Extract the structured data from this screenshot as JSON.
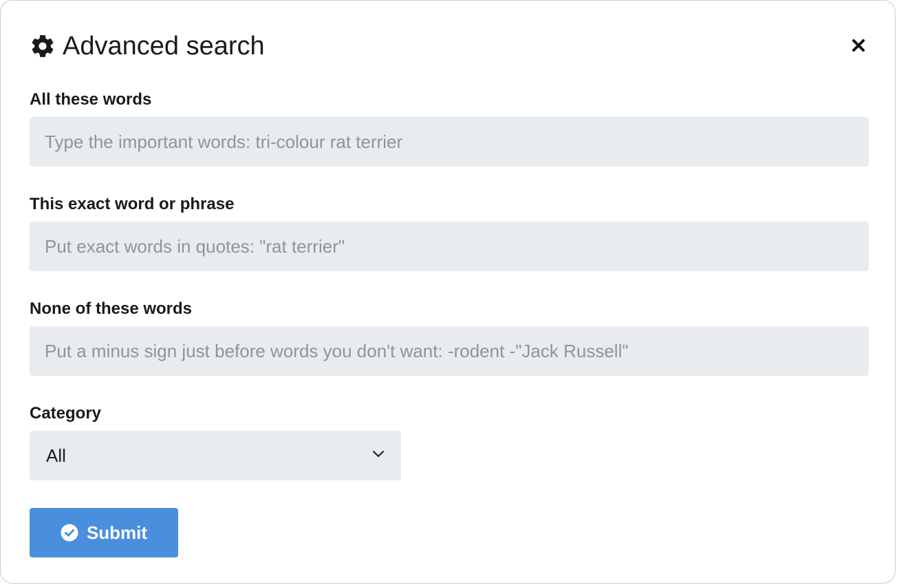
{
  "dialog": {
    "title": "Advanced search",
    "title_icon": "gear-icon",
    "close_icon": "close-icon"
  },
  "fields": {
    "all_words": {
      "label": "All these words",
      "value": "",
      "placeholder": "Type the important words: tri-colour rat terrier"
    },
    "exact_phrase": {
      "label": "This exact word or phrase",
      "value": "",
      "placeholder": "Put exact words in quotes: \"rat terrier\""
    },
    "none_words": {
      "label": "None of these words",
      "value": "",
      "placeholder": "Put a minus sign just before words you don't want: -rodent -\"Jack Russell\""
    },
    "category": {
      "label": "Category",
      "selected": "All",
      "icon": "chevron-down-icon"
    }
  },
  "submit": {
    "label": "Submit",
    "icon": "check-circle-icon",
    "color": "#4a8fdd"
  },
  "colors": {
    "input_bg": "#e9ecef",
    "placeholder": "#8a969e",
    "text": "#1a1a1a"
  }
}
